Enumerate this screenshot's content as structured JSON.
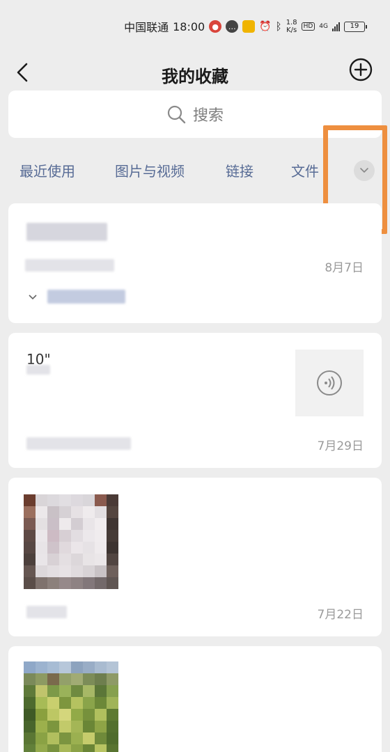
{
  "status_bar": {
    "carrier": "中国联通",
    "time": "18:00",
    "net_speed_value": "1.8",
    "net_speed_unit": "K/s",
    "hd_label": "HD",
    "network_label": "4G",
    "battery_level": "19"
  },
  "header": {
    "title": "我的收藏",
    "back_icon": "chevron-left-icon",
    "add_icon": "plus-circle-icon"
  },
  "search": {
    "placeholder": "搜索"
  },
  "tabs": [
    {
      "label": "最近使用"
    },
    {
      "label": "图片与视频"
    },
    {
      "label": "链接"
    },
    {
      "label": "文件"
    }
  ],
  "expand_icon": "chevron-down-icon",
  "items": [
    {
      "type": "file",
      "date": "8月7日"
    },
    {
      "type": "voice",
      "title": "10\"",
      "date": "7月29日"
    },
    {
      "type": "image",
      "date": "7月22日"
    },
    {
      "type": "image"
    }
  ],
  "colors": {
    "accent_link": "#576b95",
    "highlight": "#ee8f3f",
    "background": "#ededed"
  }
}
